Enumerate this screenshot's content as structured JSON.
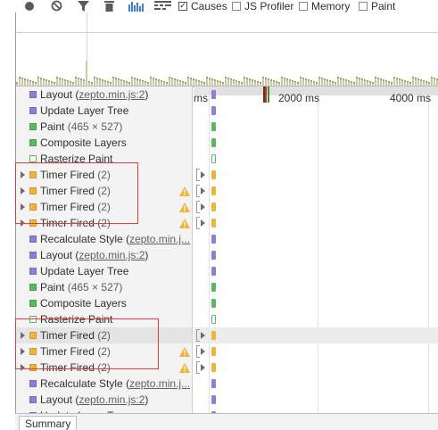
{
  "toolbar": {
    "icons": [
      "record-icon",
      "clear-icon",
      "filter-icon",
      "trash-icon",
      "frames-icon",
      "flame-icon"
    ],
    "checkboxes": [
      {
        "label": "Causes",
        "checked": true
      },
      {
        "label": "JS Profiler",
        "checked": false
      },
      {
        "label": "Memory",
        "checked": false
      },
      {
        "label": "Paint",
        "checked": false
      }
    ]
  },
  "ruler": {
    "labels": [
      "ms",
      "2000 ms",
      "4000 ms"
    ]
  },
  "colors": {
    "loading": "#8e7fd6",
    "rendering": "#8e7fd6",
    "painting": "#5cb85c",
    "scripting": "#f0b43c",
    "highlight_box": "#e0403a",
    "warning": "#f0b43c"
  },
  "records": [
    {
      "label": "Layout",
      "detail": "zepto.min.js:2",
      "detail_style": "link",
      "category": "rendering",
      "arrow": false,
      "warn": false
    },
    {
      "label": "Update Layer Tree",
      "detail": "",
      "category": "rendering",
      "arrow": false,
      "warn": false
    },
    {
      "label": "Paint",
      "detail": "(465 × 527)",
      "detail_style": "plain",
      "category": "painting",
      "arrow": false,
      "warn": false
    },
    {
      "label": "Composite Layers",
      "detail": "",
      "category": "painting",
      "arrow": false,
      "warn": false
    },
    {
      "label": "Rasterize Paint",
      "detail": "",
      "category": "painting-outline",
      "arrow": false,
      "warn": false
    },
    {
      "label": "Timer Fired",
      "detail": "(2)",
      "detail_style": "plain",
      "category": "scripting",
      "arrow": true,
      "warn": false
    },
    {
      "label": "Timer Fired",
      "detail": "(2)",
      "detail_style": "plain",
      "category": "scripting",
      "arrow": true,
      "warn": true
    },
    {
      "label": "Timer Fired",
      "detail": "(2)",
      "detail_style": "plain",
      "category": "scripting",
      "arrow": true,
      "warn": true
    },
    {
      "label": "Timer Fired",
      "detail": "(2)",
      "detail_style": "plain",
      "category": "scripting",
      "arrow": true,
      "warn": true
    },
    {
      "label": "Recalculate Style",
      "detail": "zepto.min.j...",
      "detail_style": "link",
      "category": "rendering",
      "arrow": false,
      "warn": false
    },
    {
      "label": "Layout",
      "detail": "zepto.min.js:2",
      "detail_style": "link",
      "category": "rendering",
      "arrow": false,
      "warn": false
    },
    {
      "label": "Update Layer Tree",
      "detail": "",
      "category": "rendering",
      "arrow": false,
      "warn": false
    },
    {
      "label": "Paint",
      "detail": "(465 × 527)",
      "detail_style": "plain",
      "category": "painting",
      "arrow": false,
      "warn": false
    },
    {
      "label": "Composite Layers",
      "detail": "",
      "category": "painting",
      "arrow": false,
      "warn": false
    },
    {
      "label": "Rasterize Paint",
      "detail": "",
      "category": "painting-outline",
      "arrow": false,
      "warn": false
    },
    {
      "label": "Timer Fired",
      "detail": "(2)",
      "detail_style": "plain",
      "category": "scripting",
      "arrow": true,
      "warn": false,
      "selected": true
    },
    {
      "label": "Timer Fired",
      "detail": "(2)",
      "detail_style": "plain",
      "category": "scripting",
      "arrow": true,
      "warn": true
    },
    {
      "label": "Timer Fired",
      "detail": "(2)",
      "detail_style": "plain",
      "category": "scripting",
      "arrow": true,
      "warn": true
    },
    {
      "label": "Recalculate Style",
      "detail": "zepto.min.j...",
      "detail_style": "link",
      "category": "rendering",
      "arrow": false,
      "warn": false
    },
    {
      "label": "Layout",
      "detail": "zepto.min.js:2",
      "detail_style": "link",
      "category": "rendering",
      "arrow": false,
      "warn": false
    },
    {
      "label": "Update Layer Tree",
      "detail": "",
      "category": "rendering",
      "arrow": false,
      "warn": false
    }
  ],
  "bottom": {
    "summary_tab": "Summary"
  }
}
